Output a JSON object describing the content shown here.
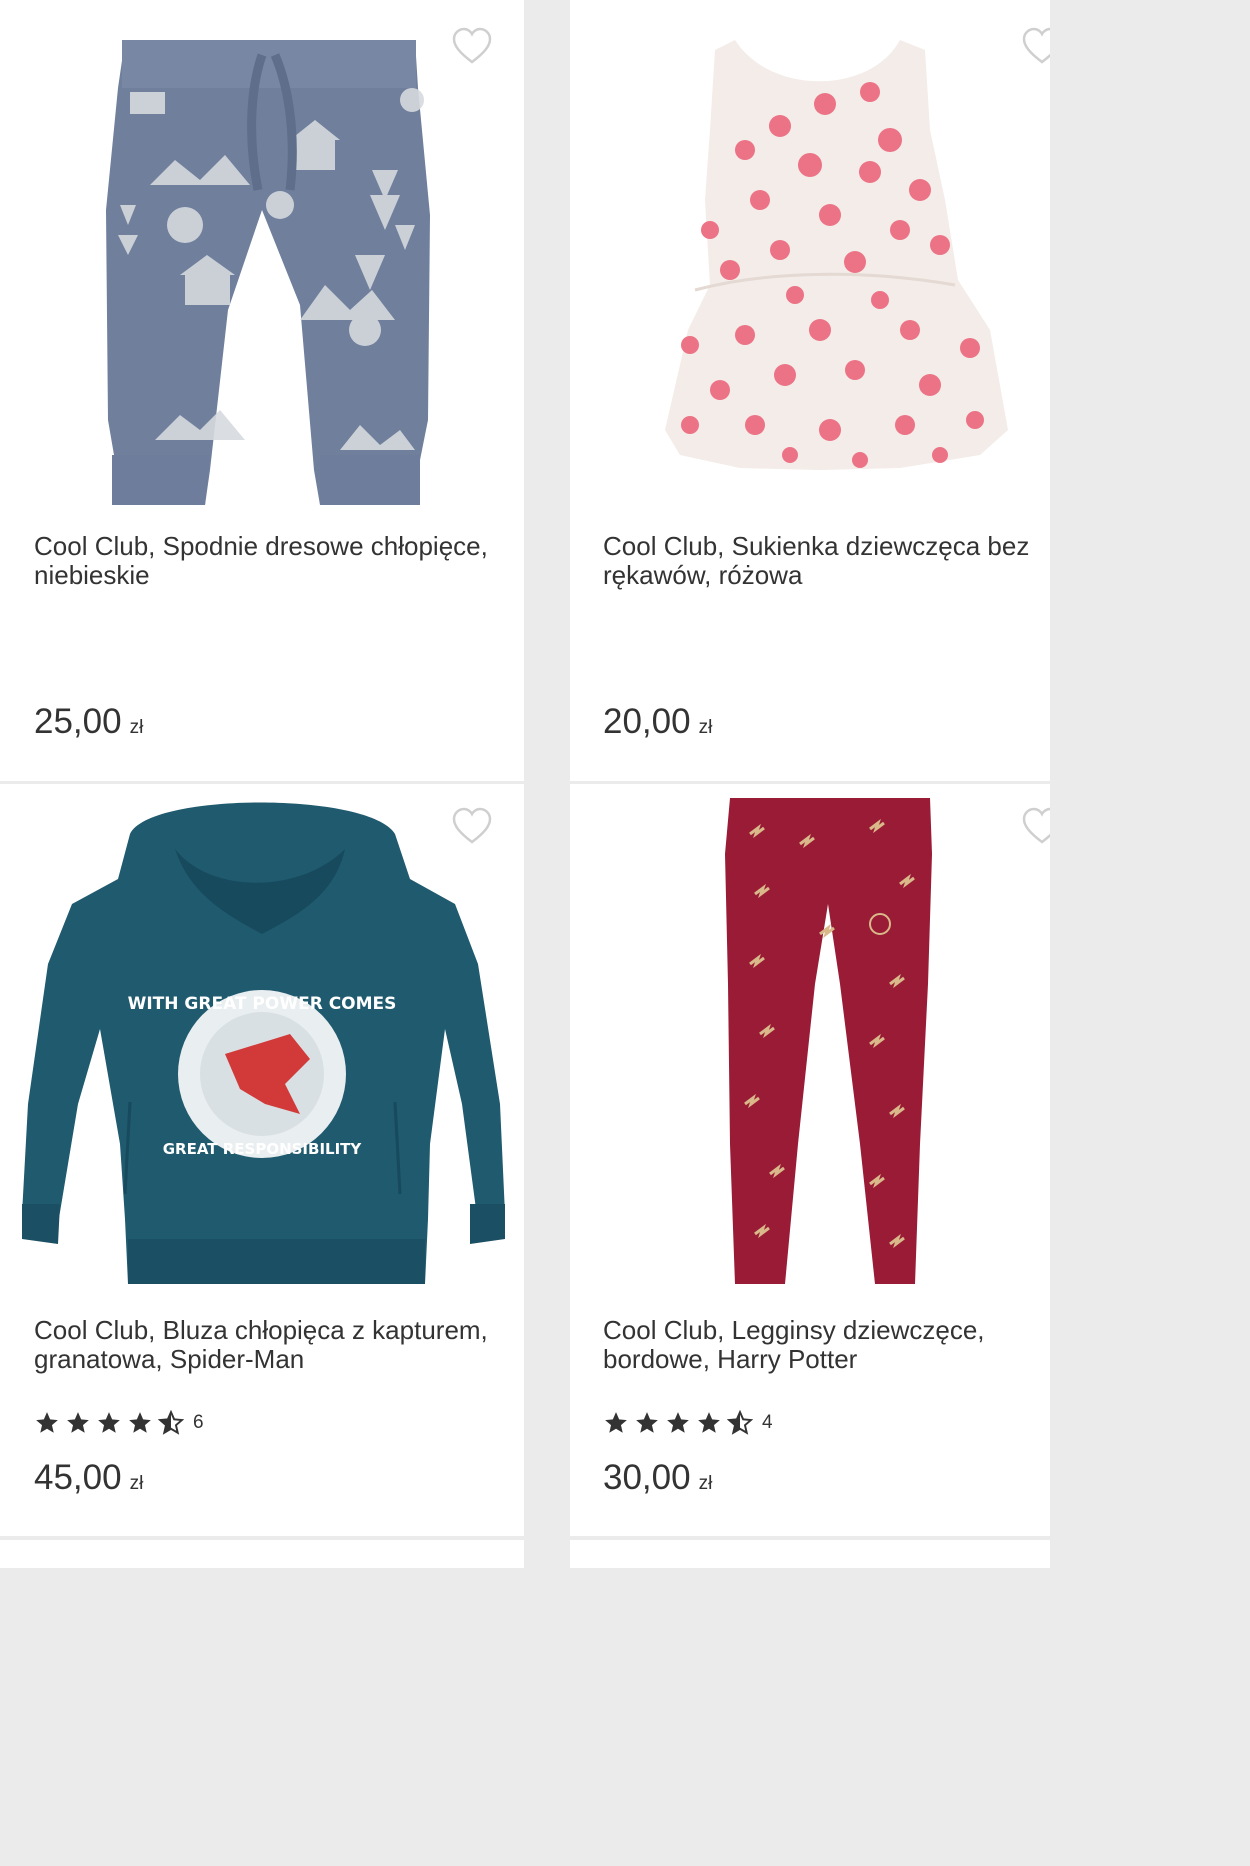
{
  "products": [
    {
      "name": "Cool Club, Spodnie dresowe chłopięce, niebieskie",
      "price": "25,00",
      "currency": "zł",
      "image_icon": "jogger-pants-image",
      "favorite_icon": "heart-outline-icon"
    },
    {
      "name": "Cool Club, Sukienka dziewczęca bez rękawów, różowa",
      "price": "20,00",
      "currency": "zł",
      "image_icon": "polka-dot-dress-image",
      "favorite_icon": "heart-outline-icon"
    },
    {
      "name": "Cool Club, Bluza chłopięca z kapturem, granatowa, Spider-Man",
      "price": "45,00",
      "currency": "zł",
      "rating": 4.5,
      "reviews": "6",
      "image_icon": "spiderman-hoodie-image",
      "favorite_icon": "heart-outline-icon",
      "print_text_top": "WITH GREAT POWER COMES",
      "print_text_bottom": "GREAT RESPONSIBILITY"
    },
    {
      "name": "Cool Club, Legginsy dziewczęce, bordowe, Harry Potter",
      "price": "30,00",
      "currency": "zł",
      "rating": 4.5,
      "reviews": "4",
      "image_icon": "harry-potter-leggings-image",
      "favorite_icon": "heart-outline-icon"
    }
  ],
  "colors": {
    "text": "#333333",
    "background": "#ebebeb",
    "card": "#ffffff",
    "star": "#333333",
    "heart": "#cfcfcf"
  }
}
